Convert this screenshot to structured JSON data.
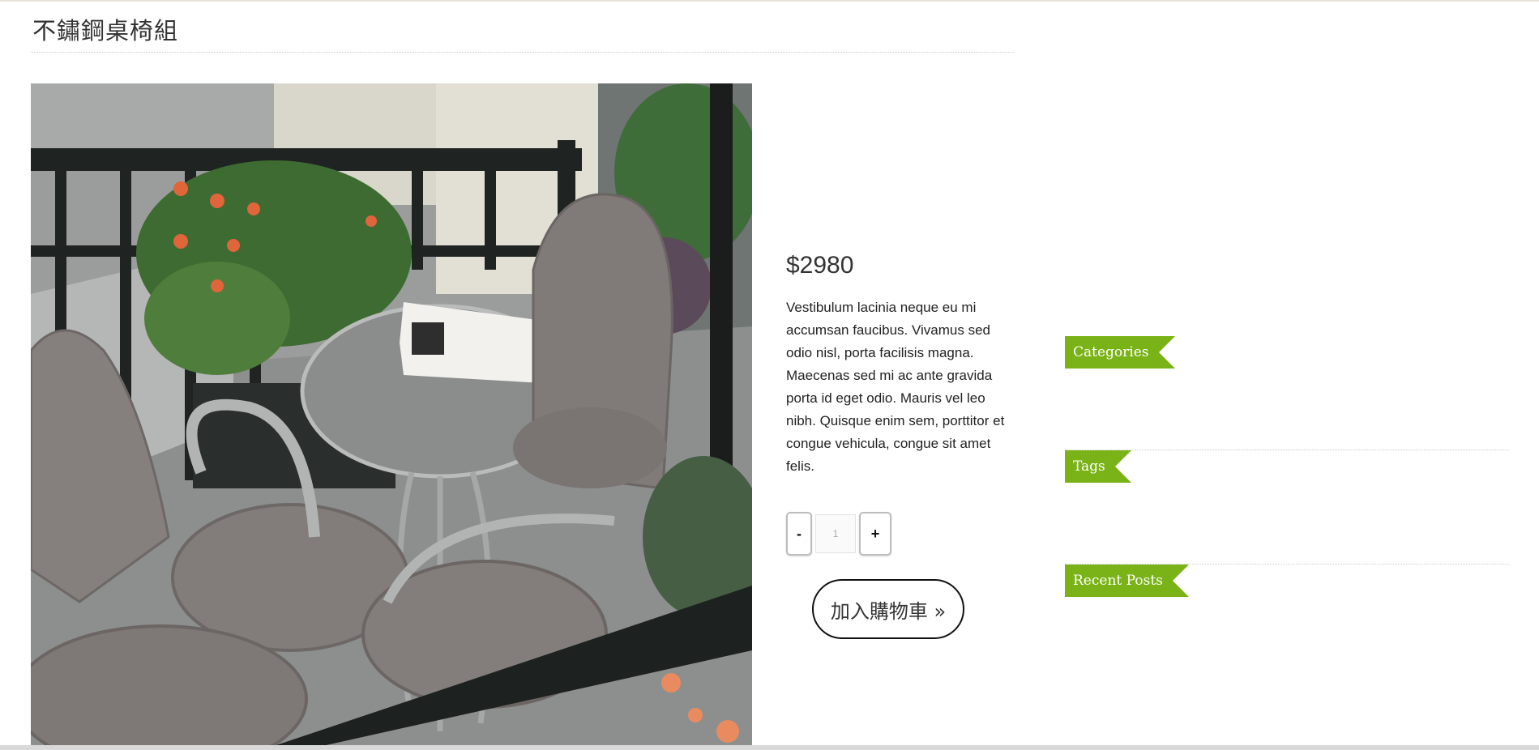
{
  "product": {
    "title": "不鏽鋼桌椅組",
    "price": "$2980",
    "description": "Vestibulum lacinia neque eu mi accumsan faucibus. Vivamus sed odio nisl, porta facilisis magna. Maecenas sed mi ac ante gravida porta id eget odio. Mauris vel leo nibh. Quisque enim sem, porttitor et congue vehicula, congue sit amet felis.",
    "quantity": {
      "minus_label": "-",
      "value": "1",
      "plus_label": "+"
    },
    "add_to_cart_label": "加入購物車 »"
  },
  "sidebar": {
    "widgets": [
      {
        "title": "Categories"
      },
      {
        "title": "Tags"
      },
      {
        "title": "Recent Posts"
      }
    ]
  },
  "colors": {
    "ribbon": "#7ab317",
    "rule": "#cfcfcf"
  }
}
